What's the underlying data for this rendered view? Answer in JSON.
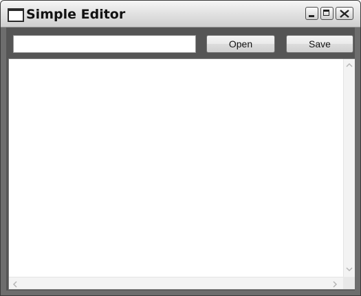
{
  "window": {
    "title": "Simple Editor"
  },
  "toolbar": {
    "path_value": "",
    "open_label": "Open",
    "save_label": "Save"
  },
  "editor": {
    "content": ""
  },
  "icons": {
    "app": "window-icon",
    "minimize": "minimize-icon",
    "maximize": "maximize-icon",
    "close": "close-icon",
    "scroll_up": "chevron-up-icon",
    "scroll_down": "chevron-down-icon",
    "scroll_left": "chevron-left-icon",
    "scroll_right": "chevron-right-icon"
  },
  "colors": {
    "frame": "#6d6d6d",
    "client_background": "#555555",
    "editor_background": "#ffffff"
  }
}
